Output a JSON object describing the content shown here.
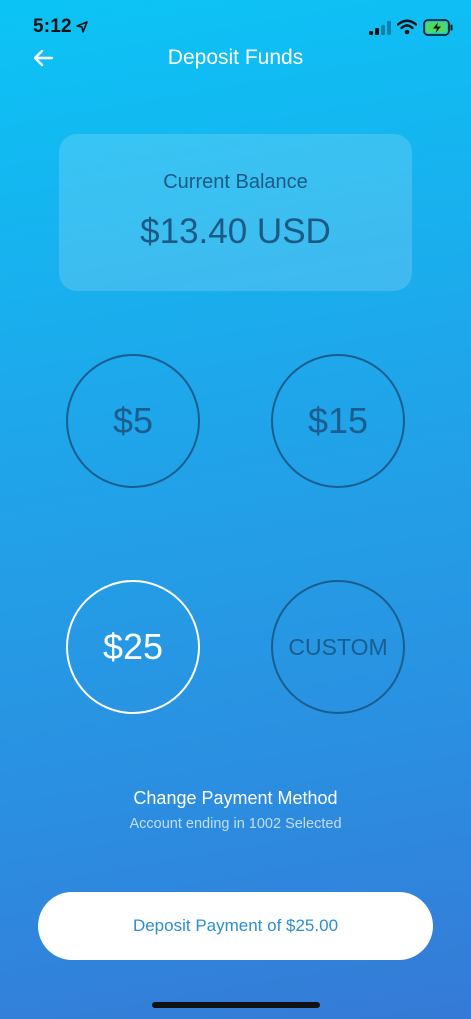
{
  "status": {
    "time": "5:12",
    "icons": [
      "location-arrow-icon",
      "signal-icon",
      "wifi-icon",
      "battery-charging-icon"
    ]
  },
  "nav": {
    "back_icon": "arrow-left-icon",
    "title": "Deposit Funds"
  },
  "balance": {
    "label": "Current Balance",
    "value": "$13.40 USD"
  },
  "amounts": [
    {
      "label": "$5",
      "selected": false
    },
    {
      "label": "$15",
      "selected": false
    },
    {
      "label": "$25",
      "selected": true
    },
    {
      "label": "CUSTOM",
      "selected": false
    }
  ],
  "payment": {
    "title": "Change Payment Method",
    "subtitle": "Account ending in 1002 Selected"
  },
  "deposit_button": {
    "label": "Deposit Payment of $25.00"
  },
  "colors": {
    "gradient_top": "#0bc4f6",
    "gradient_bottom": "#357ad6",
    "circle_border": "#1a5e8f",
    "selected_border": "#ffffff",
    "button_text": "#2b8fd1"
  }
}
